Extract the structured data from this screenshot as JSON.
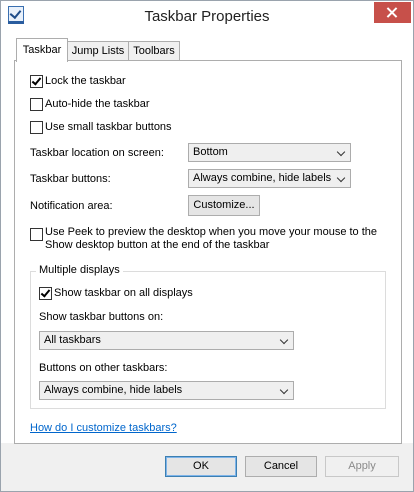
{
  "window": {
    "title": "Taskbar Properties"
  },
  "tabs": [
    {
      "label": "Taskbar"
    },
    {
      "label": "Jump Lists"
    },
    {
      "label": "Toolbars"
    }
  ],
  "taskbar": {
    "lock": {
      "label": "Lock the taskbar",
      "checked": true
    },
    "autohide": {
      "label": "Auto-hide the taskbar",
      "checked": false
    },
    "small_buttons": {
      "label": "Use small taskbar buttons",
      "checked": false
    },
    "location": {
      "label": "Taskbar location on screen:",
      "value": "Bottom"
    },
    "buttons": {
      "label": "Taskbar buttons:",
      "value": "Always combine, hide labels"
    },
    "notification": {
      "label": "Notification area:",
      "button": "Customize..."
    },
    "peek": {
      "label_line1": "Use Peek to preview the desktop when you move your mouse to the",
      "label_line2": "Show desktop button at the end of the taskbar",
      "checked": false
    }
  },
  "multiple_displays": {
    "title": "Multiple displays",
    "show_all": {
      "label": "Show taskbar on all displays",
      "checked": true
    },
    "show_buttons_on": {
      "label": "Show taskbar buttons on:",
      "value": "All taskbars"
    },
    "other_buttons": {
      "label": "Buttons on other taskbars:",
      "value": "Always combine, hide labels"
    }
  },
  "help_link": "How do I customize taskbars?",
  "footer": {
    "ok": "OK",
    "cancel": "Cancel",
    "apply": "Apply"
  },
  "colors": {
    "close_button": "#c7504a",
    "link": "#0066cc",
    "accent_border": "#3c7fb1"
  }
}
